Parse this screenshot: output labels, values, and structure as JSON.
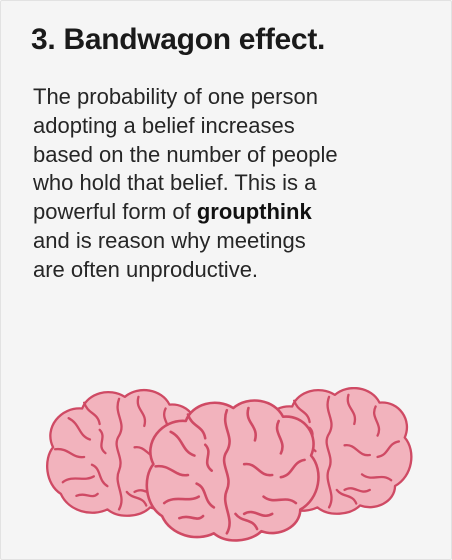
{
  "heading": "3. Bandwagon effect.",
  "body": {
    "line1": "The probability of one person",
    "line2": "adopting a belief increases",
    "line3": "based on the number of people",
    "line4": "who hold that belief. This is a",
    "line5_before": "powerful form of ",
    "line5_bold": "groupthink",
    "line6": "and is reason why meetings",
    "line7": "are often unproductive."
  },
  "illustration": {
    "icon": "brain-icon",
    "count": 3,
    "fill_color": "#f2b3bd",
    "stroke_color": "#cf4a64",
    "background_color": "#f5f5f5"
  }
}
